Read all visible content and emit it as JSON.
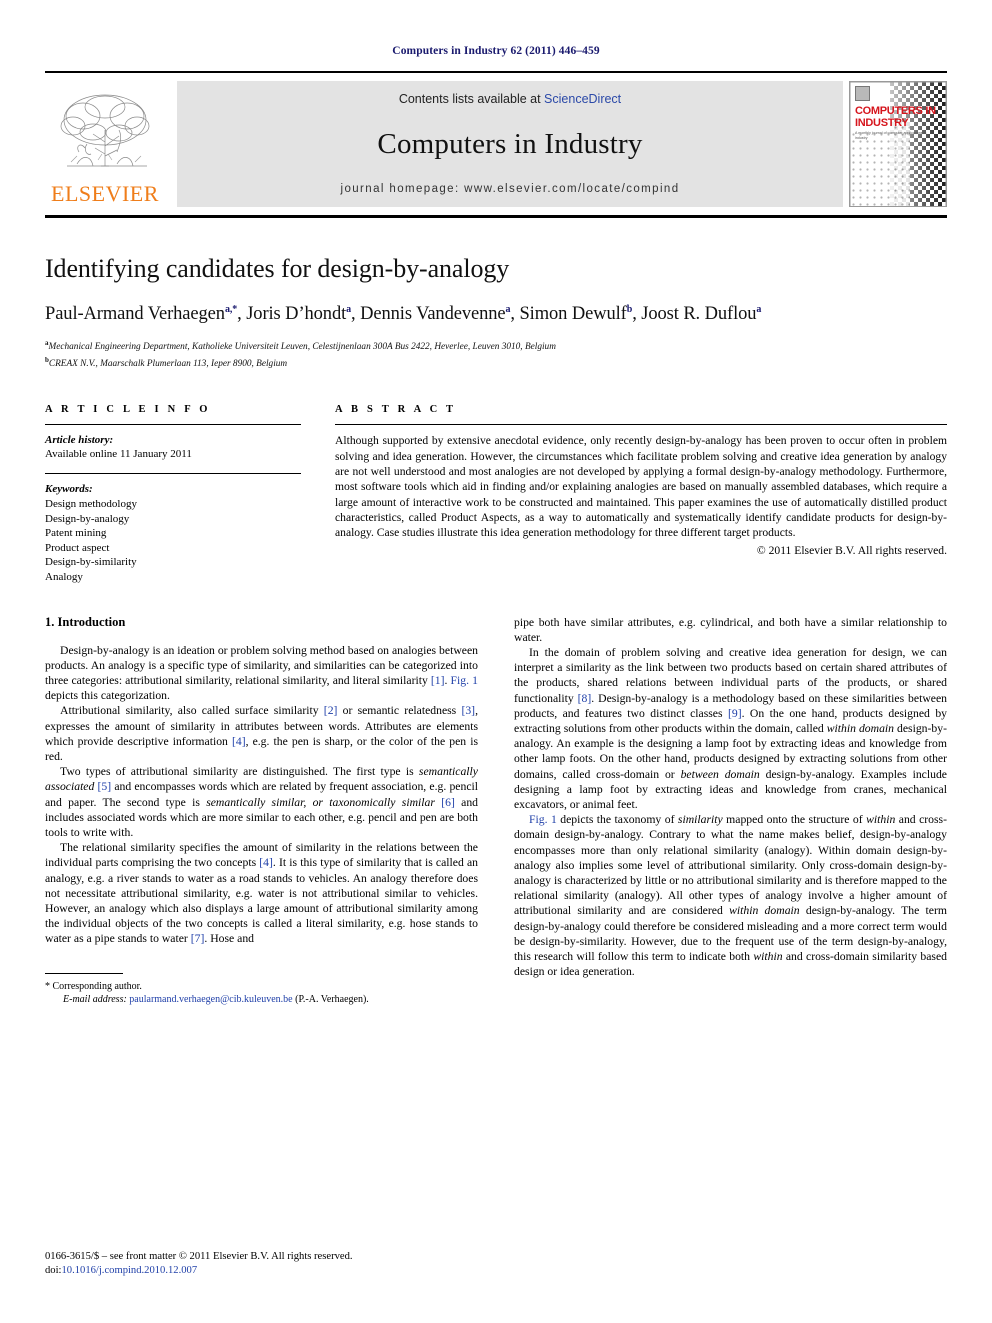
{
  "running_head": "Computers in Industry 62 (2011) 446–459",
  "masthead": {
    "publisher_name": "ELSEVIER",
    "publisher_logo_name": "elsevier-tree-logo",
    "contents_prefix": "Contents lists available at ",
    "contents_link": "ScienceDirect",
    "journal_name": "Computers in Industry",
    "homepage_line": "journal homepage: www.elsevier.com/locate/compind",
    "cover": {
      "title_line1": "COMPUTERS IN",
      "title_line2": "INDUSTRY",
      "subtitle": "A monthly journal of computer applications in industry"
    }
  },
  "article": {
    "title": "Identifying candidates for design-by-analogy",
    "authors": [
      {
        "name": "Paul-Armand Verhaegen",
        "sup": "a,*"
      },
      {
        "name": "Joris D’hondt",
        "sup": "a"
      },
      {
        "name": "Dennis Vandevenne",
        "sup": "a"
      },
      {
        "name": "Simon Dewulf",
        "sup": "b"
      },
      {
        "name": "Joost R. Duflou",
        "sup": "a"
      }
    ],
    "affiliations": [
      {
        "marker": "a",
        "text": "Mechanical Engineering Department, Katholieke Universiteit Leuven, Celestijnenlaan 300A Bus 2422, Heverlee, Leuven 3010, Belgium"
      },
      {
        "marker": "b",
        "text": "CREAX N.V., Maarschalk Plumerlaan 113, Ieper 8900, Belgium"
      }
    ]
  },
  "article_info": {
    "heading": "A R T I C L E  I N F O",
    "history_label": "Article history:",
    "history_value": "Available online 11 January 2011",
    "keywords_label": "Keywords:",
    "keywords": [
      "Design methodology",
      "Design-by-analogy",
      "Patent mining",
      "Product aspect",
      "Design-by-similarity",
      "Analogy"
    ]
  },
  "abstract": {
    "heading": "A B S T R A C T",
    "text": "Although supported by extensive anecdotal evidence, only recently design-by-analogy has been proven to occur often in problem solving and idea generation. However, the circumstances which facilitate problem solving and creative idea generation by analogy are not well understood and most analogies are not developed by applying a formal design-by-analogy methodology. Furthermore, most software tools which aid in finding and/or explaining analogies are based on manually assembled databases, which require a large amount of interactive work to be constructed and maintained. This paper examines the use of automatically distilled product characteristics, called Product Aspects, as a way to automatically and systematically identify candidate products for design-by-analogy. Case studies illustrate this idea generation methodology for three different target products.",
    "copyright": "© 2011 Elsevier B.V. All rights reserved."
  },
  "body": {
    "section_number_title": "1. Introduction",
    "left_paragraphs": [
      "Design-by-analogy is an ideation or problem solving method based on analogies between products. An analogy is a specific type of similarity, and similarities can be categorized into three categories: attributional similarity, relational similarity, and literal similarity [1]. Fig. 1 depicts this categorization.",
      "Attributional similarity, also called surface similarity [2] or semantic relatedness [3], expresses the amount of similarity in attributes between words. Attributes are elements which provide descriptive information [4], e.g. the pen is sharp, or the color of the pen is red.",
      "Two types of attributional similarity are distinguished. The first type is semantically associated [5] and encompasses words which are related by frequent association, e.g. pencil and paper. The second type is semantically similar, or taxonomically similar [6] and includes associated words which are more similar to each other, e.g. pencil and pen are both tools to write with.",
      "The relational similarity specifies the amount of similarity in the relations between the individual parts comprising the two concepts [4]. It is this type of similarity that is called an analogy, e.g. a river stands to water as a road stands to vehicles. An analogy therefore does not necessitate attributional similarity, e.g. water is not attributional similar to vehicles. However, an analogy which also displays a large amount of attributional similarity among the individual objects of the two concepts is called a literal similarity, e.g. hose stands to water as a pipe stands to water [7]. Hose and"
    ],
    "right_paragraphs": [
      "pipe both have similar attributes, e.g. cylindrical, and both have a similar relationship to water.",
      "In the domain of problem solving and creative idea generation for design, we can interpret a similarity as the link between two products based on certain shared attributes of the products, shared relations between individual parts of the products, or shared functionality [8]. Design-by-analogy is a methodology based on these similarities between products, and features two distinct classes [9]. On the one hand, products designed by extracting solutions from other products within the domain, called within domain design-by-analogy. An example is the designing a lamp foot by extracting ideas and knowledge from other lamp foots. On the other hand, products designed by extracting solutions from other domains, called cross-domain or between domain design-by-analogy. Examples include designing a lamp foot by extracting ideas and knowledge from cranes, mechanical excavators, or animal feet.",
      "Fig. 1 depicts the taxonomy of similarity mapped onto the structure of within and cross-domain design-by-analogy. Contrary to what the name makes belief, design-by-analogy encompasses more than only relational similarity (analogy). Within domain design-by-analogy also implies some level of attributional similarity. Only cross-domain design-by-analogy is characterized by little or no attributional similarity and is therefore mapped to the relational similarity (analogy). All other types of analogy involve a higher amount of attributional similarity and are considered within domain design-by-analogy. The term design-by-analogy could therefore be considered misleading and a more correct term would be design-by-similarity. However, due to the frequent use of the term design-by-analogy, this research will follow this term to indicate both within and cross-domain similarity based design or idea generation."
    ]
  },
  "footnote": {
    "marker": "*",
    "corresponding": "Corresponding author.",
    "email_label": "E-mail address:",
    "email": "paularmand.verhaegen@cib.kuleuven.be",
    "email_suffix": "(P.-A. Verhaegen)."
  },
  "issn_footer": {
    "line1": "0166-3615/$ – see front matter © 2011 Elsevier B.V. All rights reserved.",
    "doi_label": "doi:",
    "doi_value": "10.1016/j.compind.2010.12.007"
  },
  "colors": {
    "running_head": "#1a1a6e",
    "link": "#1f3fa8",
    "sciencedirect": "#2b49a8",
    "elsevier_orange": "#ef7d1a",
    "cover_red": "#d6151d",
    "band_gray": "#e3e3e3"
  }
}
